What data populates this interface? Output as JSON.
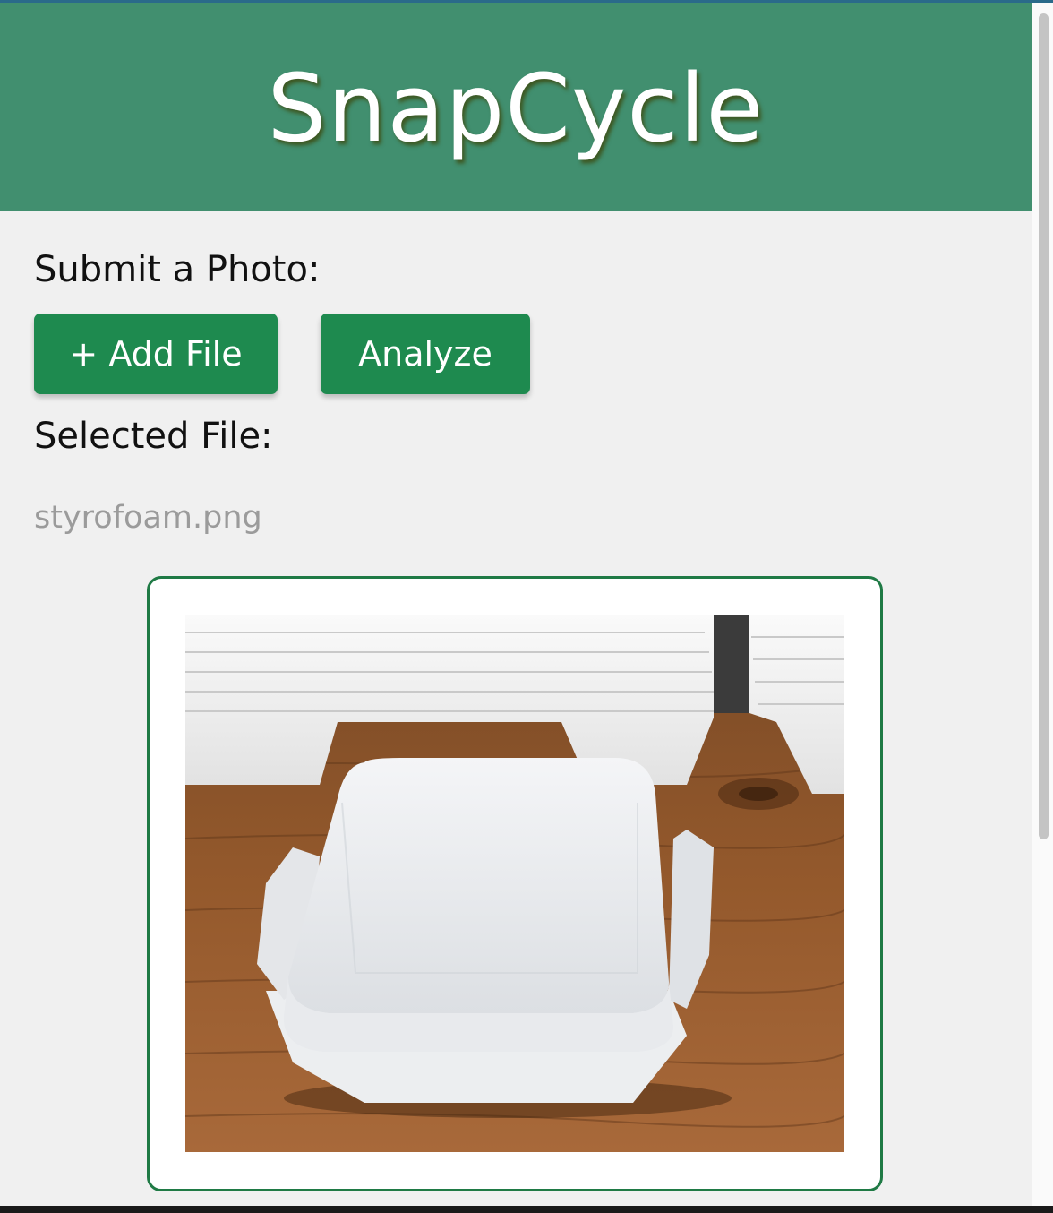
{
  "app": {
    "title": "SnapCycle"
  },
  "upload": {
    "submit_label": "Submit a Photo:",
    "add_file_label": "+ Add File",
    "analyze_label": "Analyze",
    "selected_label": "Selected File:",
    "file_name": "styrofoam.png"
  },
  "preview": {
    "image_subject": "white styrofoam takeout container on wooden table with stacked containers behind"
  },
  "colors": {
    "header_bg": "#418f6f",
    "button_bg": "#1e8a4f",
    "card_border": "#1f7a45",
    "page_bg": "#f0f0f0"
  }
}
